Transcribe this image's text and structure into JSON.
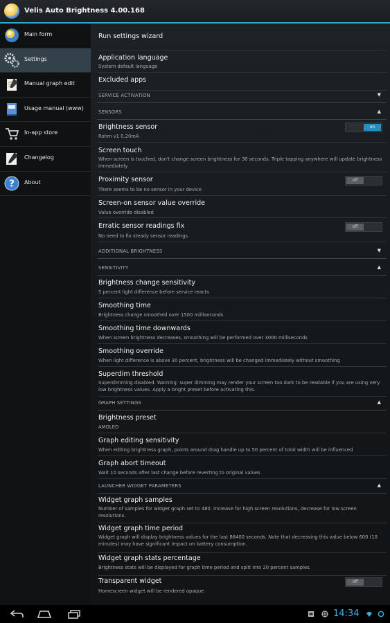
{
  "app": {
    "title": "Velis Auto Brightness 4.00.168"
  },
  "sidebar": {
    "items": [
      {
        "label": "Main form",
        "icon": "sun-icon"
      },
      {
        "label": "Settings",
        "icon": "gears-icon"
      },
      {
        "label": "Manual graph edit",
        "icon": "notepad-icon"
      },
      {
        "label": "Usage manual (www)",
        "icon": "book-icon"
      },
      {
        "label": "In-app store",
        "icon": "cart-icon"
      },
      {
        "label": "Changelog",
        "icon": "pencil-icon"
      },
      {
        "label": "About",
        "icon": "help-icon"
      }
    ]
  },
  "prefs": {
    "wizard": {
      "title": "Run settings wizard"
    },
    "language": {
      "title": "Application language",
      "summary": "System default language"
    },
    "excluded": {
      "title": "Excluded apps"
    },
    "cat_service": {
      "title": "SERVICE ACTIVATION"
    },
    "cat_sensors": {
      "title": "SENSORS"
    },
    "brightness_sensor": {
      "title": "Brightness sensor",
      "summary": "Rohm v1 0.20mA",
      "toggle": "on"
    },
    "screen_touch": {
      "title": "Screen touch",
      "summary": "When screen is touched, don't change screen brightness for 30 seconds. Triple tapping anywhere will update brightness immediately"
    },
    "proximity": {
      "title": "Proximity sensor",
      "summary": "There seems to be no sensor in your device",
      "toggle": "off"
    },
    "override": {
      "title": "Screen-on sensor value override",
      "summary": "Value override disabled"
    },
    "erratic": {
      "title": "Erratic sensor readings fix",
      "summary": "No need to fix steady sensor readings",
      "toggle": "off"
    },
    "cat_additional": {
      "title": "ADDITIONAL BRIGHTNESS"
    },
    "cat_sensitivity": {
      "title": "SENSITIVITY"
    },
    "change_sens": {
      "title": "Brightness change sensitivity",
      "summary": "5 percent light difference before service reacts"
    },
    "smoothing": {
      "title": "Smoothing time",
      "summary": "Brightness change smoothed over 1500 milliseconds"
    },
    "smoothing_down": {
      "title": "Smoothing time downwards",
      "summary": "When screen brightness decreases, smoothing will be performed over 3000 milliseconds"
    },
    "smoothing_override": {
      "title": "Smoothing override",
      "summary": "When light difference is above 30 percent, brightness will be changed immediately without smoothing"
    },
    "superdim": {
      "title": "Superdim threshold",
      "summary": "Superdimming disabled. Warning: super dimming may render your screen too dark to be readable if you are using very low brightness values. Apply a bright preset before activating this."
    },
    "cat_graph": {
      "title": "GRAPH SETTINGS"
    },
    "preset": {
      "title": "Brightness preset",
      "summary": "AMOLED"
    },
    "graph_sens": {
      "title": "Graph editing sensitivity",
      "summary": "When editing brightness graph, points around drag handle up to 50 percent of total width will be influenced"
    },
    "graph_abort": {
      "title": "Graph abort timeout",
      "summary": "Wait 10 seconds after last change before reverting to original values"
    },
    "cat_widget": {
      "title": "LAUNCHER WIDGET PARAMETERS"
    },
    "widget_samples": {
      "title": "Widget graph samples",
      "summary": "Number of samples for widget graph set to 480. Increase for high screen resolutions, decrease for low screen resolutions."
    },
    "widget_period": {
      "title": "Widget graph time period",
      "summary": "Widget graph will display brightness values for the last 86400 seconds. Note that decreasing this value below 600 (10 minutes) may have significant impact on battery consumption."
    },
    "widget_stats": {
      "title": "Widget graph stats percentage",
      "summary": "Brightness stats will be displayed for graph time period and split into 20 percent samples."
    },
    "transparent": {
      "title": "Transparent widget",
      "summary": "Homescreen widget will be rendered opaque",
      "toggle": "off"
    }
  },
  "status": {
    "time": "14:34"
  },
  "colors": {
    "accent": "#2aa5d4",
    "clock": "#36b1e5"
  }
}
